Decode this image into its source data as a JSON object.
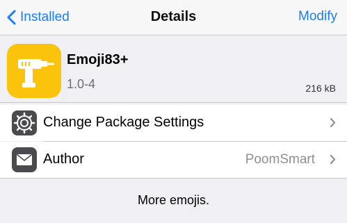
{
  "navbar": {
    "back_label": "Installed",
    "title": "Details",
    "action_label": "Modify"
  },
  "package": {
    "name": "Emoji83+",
    "version": "1.0-4",
    "size": "216 kB",
    "icon": "drill-icon",
    "icon_background": "#fcc30c"
  },
  "rows": [
    {
      "label": "Change Package Settings",
      "value": "",
      "icon": "gear-icon"
    },
    {
      "label": "Author",
      "value": "PoomSmart",
      "icon": "mail-icon"
    }
  ],
  "description": "More emojis.",
  "colors": {
    "accent": "#1a7cf5",
    "background": "#efeff4",
    "row_icon": "#4a4a4f"
  }
}
